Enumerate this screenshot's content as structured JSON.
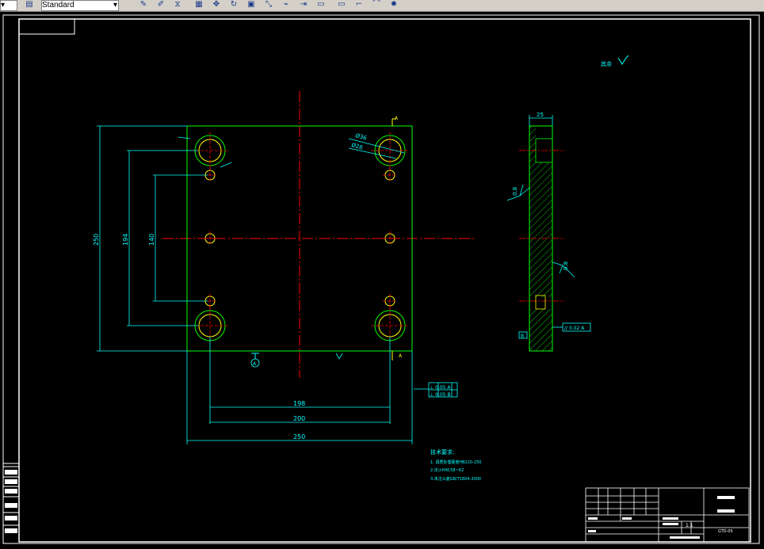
{
  "toolbar": {
    "style_combo": "Standard",
    "buttons": [
      {
        "name": "edit-pencil-icon",
        "glyph": "✎"
      },
      {
        "name": "paint-icon",
        "glyph": "✐"
      },
      {
        "name": "mirror-icon",
        "glyph": "⧖"
      },
      {
        "name": "array-icon",
        "glyph": "▦"
      },
      {
        "name": "move-icon",
        "glyph": "✥"
      },
      {
        "name": "rotate-icon",
        "glyph": "↻"
      },
      {
        "name": "scale-icon",
        "glyph": "▣"
      },
      {
        "name": "stretch-icon",
        "glyph": "⤡"
      },
      {
        "name": "trim-icon",
        "glyph": "⌁"
      },
      {
        "name": "extend-icon",
        "glyph": "⇥"
      },
      {
        "name": "break-icon",
        "glyph": "▭"
      },
      {
        "name": "join-icon",
        "glyph": "▭"
      },
      {
        "name": "chamfer-icon",
        "glyph": "⌐"
      },
      {
        "name": "fillet-icon",
        "glyph": "⌒"
      },
      {
        "name": "explode-icon",
        "glyph": "✸"
      }
    ]
  },
  "drawing": {
    "colors": {
      "frame": "#ffffff",
      "outline": "#00ff00",
      "dimension": "#00ffff",
      "centerline": "#ff0000",
      "hole": "#ffff00",
      "hatch": "#00ff00"
    },
    "roughness_note": "其余",
    "dimensions": {
      "plate_width": "250",
      "plate_height": "250",
      "outer_span": "194",
      "inner_span": "140",
      "hole_span_x_inner": "198",
      "hole_span_x_outer": "200",
      "side_thickness": "25",
      "big_hole_dia": "Ø36",
      "small_hole_dia": "Ø28",
      "roughness_side_top": "0.8",
      "roughness_side_mid": "0.8",
      "parallelism": "// 0.02 A",
      "perpendicularity_1": "⊥ 0.05 A",
      "perpendicularity_2": "⊥ 0.05 B",
      "datum_a": "A",
      "datum_b": "B"
    },
    "tech_notes": {
      "title": "技术要求:",
      "lines": [
        "1. 调质处理硬度HB220-250",
        "2.淬火HRC58~62",
        "3.未注公差GB/T1804-2000"
      ]
    },
    "title_block": {
      "scale": "1:1",
      "drawing_no": "GTD-05"
    }
  }
}
